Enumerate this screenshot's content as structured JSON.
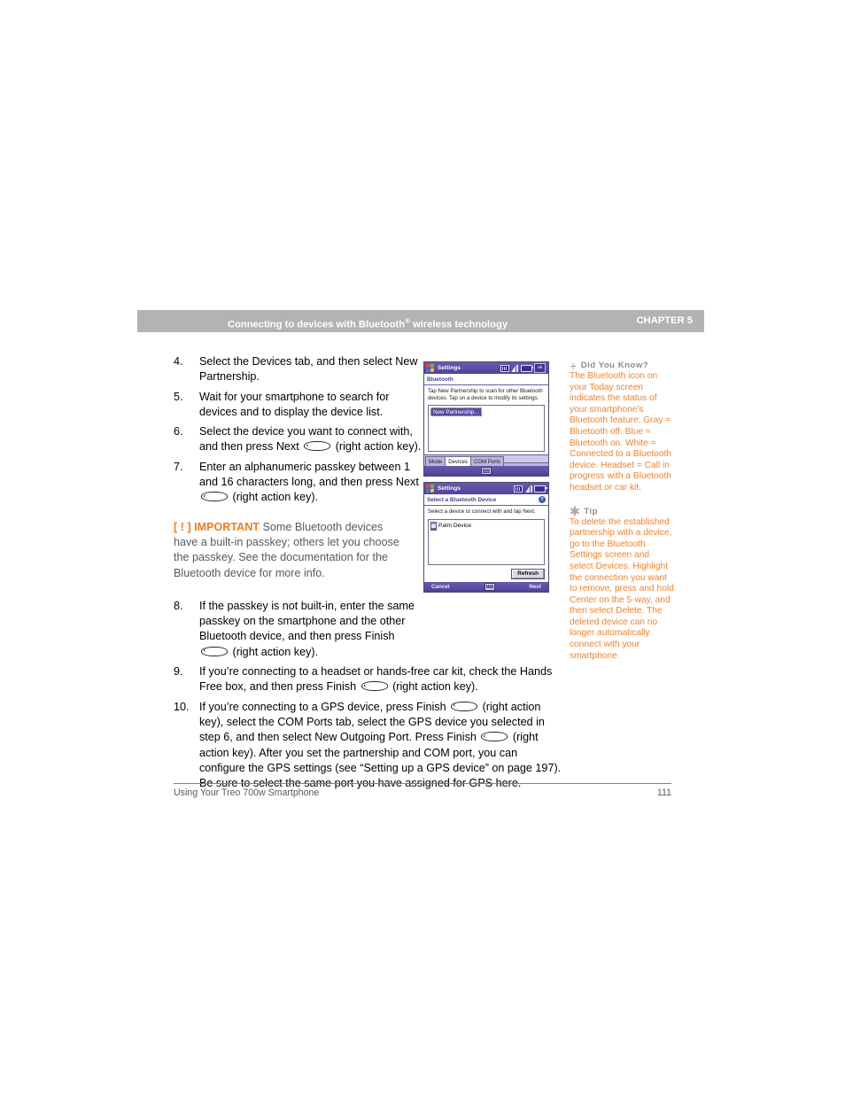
{
  "running_head": {
    "title_before": "Connecting to devices with Bluetooth",
    "title_sup": "®",
    "title_after": " wireless technology",
    "chapter": "CHAPTER 5"
  },
  "steps": [
    {
      "number": "4.",
      "text_parts": [
        {
          "type": "text",
          "value": "Select the Devices tab, and then select New Partnership."
        }
      ]
    },
    {
      "number": "5.",
      "text_parts": [
        {
          "type": "text",
          "value": "Wait for your smartphone to search for devices and to display the device list."
        }
      ]
    },
    {
      "number": "6.",
      "text_parts": [
        {
          "type": "text",
          "value": "Select the device you want to connect with, and then press Next "
        },
        {
          "type": "key",
          "value": "right-action-key"
        },
        {
          "type": "text",
          "value": " (right action key)."
        }
      ]
    },
    {
      "number": "7.",
      "text_parts": [
        {
          "type": "text",
          "value": "Enter an alphanumeric passkey between 1 and 16 characters long, and then press Next "
        },
        {
          "type": "key",
          "value": "right-action-key"
        },
        {
          "type": "text",
          "value": " (right action key)."
        }
      ]
    }
  ],
  "important": {
    "label": "[ ! ] IMPORTANT",
    "text": "Some Bluetooth devices have a built-in passkey; others let you choose the passkey. See the documentation for the Bluetooth device for more info."
  },
  "steps2": [
    {
      "number": "8.",
      "text_parts": [
        {
          "type": "text",
          "value": "If the passkey is not built-in, enter the same passkey on the smartphone and the other Bluetooth device, and then press Finish "
        },
        {
          "type": "key",
          "value": "right-action-key"
        },
        {
          "type": "text",
          "value": " (right action key)."
        }
      ]
    }
  ],
  "steps3": [
    {
      "number": "9.",
      "text_parts": [
        {
          "type": "text",
          "value": "If you’re connecting to a headset or hands-free car kit, check the Hands Free box, and then press Finish "
        },
        {
          "type": "key",
          "value": "right-action-key"
        },
        {
          "type": "text",
          "value": " (right action key)."
        }
      ]
    },
    {
      "number": "10.",
      "text_parts": [
        {
          "type": "text",
          "value": "If you’re connecting to a GPS device, press Finish "
        },
        {
          "type": "key",
          "value": "right-action-key"
        },
        {
          "type": "text",
          "value": " (right action key), select the COM Ports tab, select the GPS device you selected in step 6, and then select New Outgoing Port. Press Finish "
        },
        {
          "type": "key",
          "value": "right-action-key"
        },
        {
          "type": "text",
          "value": " (right action key). After you set the partnership and COM port, you can configure the GPS settings (see “Setting up a GPS device” on page 197). Be sure to select the same port you have assigned for GPS here."
        }
      ]
    }
  ],
  "screenshots": [
    {
      "name": "bluetooth-settings-devices",
      "titlebar": {
        "app_label": "Settings",
        "icons": [
          "windows-flag-icon",
          "text-input-icon",
          "signal-icon",
          "battery-icon",
          "ok-button"
        ],
        "ok_label": "ok"
      },
      "subbar": {
        "title": "Bluetooth",
        "help": ""
      },
      "instruction": "Tap New Partnership to scan for other Bluetooth devices. Tap on a device to modify its settings.",
      "list": [
        {
          "label": "New Partnership...",
          "selected": true
        }
      ],
      "tabs": [
        {
          "label": "Mode",
          "active": false
        },
        {
          "label": "Devices",
          "active": true
        },
        {
          "label": "COM Ports",
          "active": false
        }
      ],
      "bottombar": {
        "left": "",
        "center_icon": "keyboard-icon",
        "right": ""
      }
    },
    {
      "name": "select-a-bluetooth-device",
      "titlebar": {
        "app_label": "Settings",
        "icons": [
          "windows-flag-icon",
          "text-input-icon",
          "signal-icon",
          "battery-icon"
        ],
        "ok_label": ""
      },
      "subbar": {
        "title": "Select a Bluetooth Device",
        "help": "?"
      },
      "instruction": "Select a device to connect with and tap Next.",
      "list": [
        {
          "label": "Palm Device",
          "selected": false
        }
      ],
      "refresh_label": "Refresh",
      "bottombar": {
        "left": "Cancel",
        "center_icon": "keyboard-icon",
        "right": "Next"
      }
    }
  ],
  "notes": [
    {
      "glyph": "+",
      "heading": "Did You Know?",
      "body": "The Bluetooth icon on your Today screen indicates the status of your smartphone’s Bluetooth feature: Gray = Bluetooth off. Blue = Bluetooth on. White = Connected to a Bluetooth device. Headset = Call in progress with a Bluetooth headset or car kit."
    },
    {
      "glyph": "✱",
      "heading": "Tip",
      "body": "To delete the established partnership with a device, go to the Bluetooth Settings screen and select Devices. Highlight the connection you want to remove, press and hold Center on the 5-way, and then select Delete. The deleted device can no longer automatically connect with your smartphone."
    }
  ],
  "footer": {
    "left": "Using Your Treo 700w Smartphone",
    "page_number": "111"
  },
  "colors": {
    "accent_orange": "#f5822a",
    "important_orange": "#f07c22",
    "runhead_gray": "#b3b3b3",
    "device_purple": "#5b4b9e"
  }
}
